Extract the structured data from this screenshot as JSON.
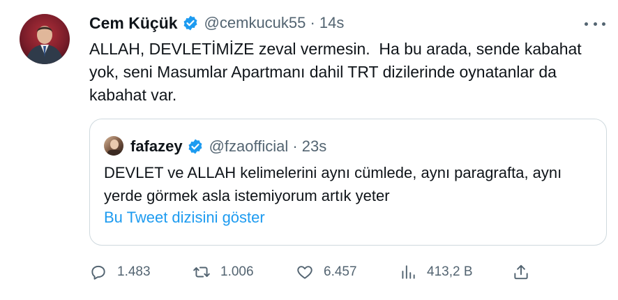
{
  "tweet": {
    "author_name": "Cem Küçük",
    "author_handle": "@cemkucuk55 · 14s",
    "text": "ALLAH, DEVLETİMİZE zeval vermesin.  Ha bu arada, sende kabahat yok, seni Masumlar Apartmanı dahil TRT dizilerinde oynatanlar da kabahat var."
  },
  "quote": {
    "author_name": "fafazey",
    "author_handle": "@fzaofficial · 23s",
    "text": "DEVLET ve ALLAH kelimelerini aynı cümlede, aynı paragrafta, aynı yerde görmek asla istemiyorum artık yeter",
    "thread_link": "Bu Tweet dizisini göster"
  },
  "actions": {
    "replies": "1.483",
    "retweets": "1.006",
    "likes": "6.457",
    "views": "413,2 B"
  },
  "colors": {
    "verified": "#1d9bf0",
    "muted": "#536471",
    "link": "#1d9bf0"
  }
}
